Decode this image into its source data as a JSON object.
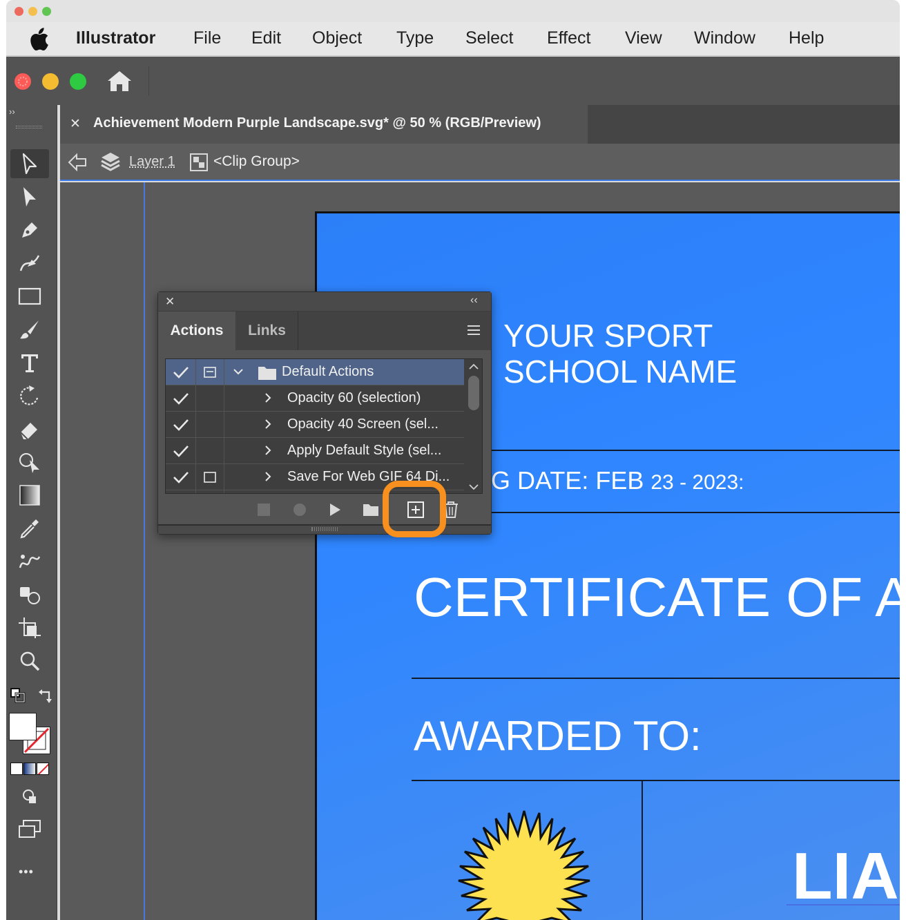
{
  "menubar": {
    "app_name": "Illustrator",
    "items": [
      "File",
      "Edit",
      "Object",
      "Type",
      "Select",
      "Effect",
      "View",
      "Window",
      "Help"
    ]
  },
  "document": {
    "tab_title": "Achievement Modern Purple Landscape.svg* @ 50 % (RGB/Preview)",
    "close_glyph": "✕"
  },
  "breadcrumb": {
    "layer": "Layer 1",
    "group": "<Clip Group>"
  },
  "toolbar": {
    "collapse_glyph": "››",
    "more_glyph": "•••"
  },
  "panel": {
    "close_glyph": "✕",
    "collapse_glyph": "‹‹",
    "tabs": [
      "Actions",
      "Links"
    ],
    "active_tab": "Actions",
    "rows": [
      {
        "label": "Default Actions",
        "checked": true,
        "dialog": true,
        "is_set": true,
        "selected": true
      },
      {
        "label": "Opacity 60 (selection)",
        "checked": true,
        "dialog": false,
        "is_set": false,
        "selected": false
      },
      {
        "label": "Opacity 40 Screen (sel...",
        "checked": true,
        "dialog": false,
        "is_set": false,
        "selected": false
      },
      {
        "label": "Apply Default Style (sel...",
        "checked": true,
        "dialog": false,
        "is_set": false,
        "selected": false
      },
      {
        "label": "Save For Web GIF 64 Di...",
        "checked": true,
        "dialog": true,
        "is_set": false,
        "selected": false
      }
    ],
    "footer_buttons": [
      "stop-playing-button",
      "begin-recording-button",
      "play-selection-button",
      "create-new-set-button",
      "create-new-action-button",
      "delete-selection-button"
    ],
    "highlighted_button": "create-new-action-button",
    "highlight_color": "#f7901e"
  },
  "artboard": {
    "school_line1": "YOUR SPORT",
    "school_line2": "SCHOOL NAME",
    "date_label": "G DATE: FEB ",
    "date_value": "23 - 2023:",
    "certificate": "CERTIFICATE OF A",
    "awarded": "AWARDED TO:",
    "name_partial": "LIA",
    "accent": "#2f86ff",
    "seal_color": "#fde151"
  }
}
